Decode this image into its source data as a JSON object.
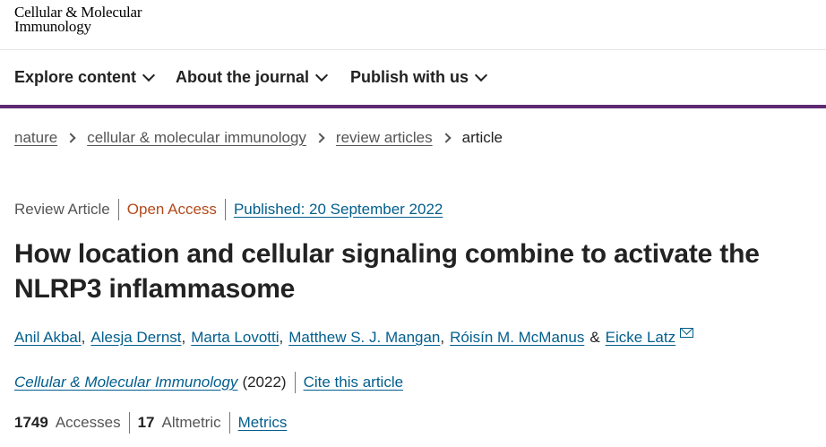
{
  "logo": {
    "line1": "Cellular & Molecular",
    "line2": "Immunology"
  },
  "nav": {
    "explore": "Explore content",
    "about": "About the journal",
    "publish": "Publish with us"
  },
  "breadcrumb": {
    "items": [
      "nature",
      "cellular & molecular immunology",
      "review articles"
    ],
    "current": "article"
  },
  "meta": {
    "article_type": "Review Article",
    "open_access": "Open Access",
    "published": "Published: 20 September 2022"
  },
  "title": "How location and cellular signaling combine to activate the NLRP3 inflammasome",
  "authors": [
    "Anil Akbal",
    "Alesja Dernst",
    "Marta Lovotti",
    "Matthew S. J. Mangan",
    "Róisín M. McManus",
    "Eicke Latz"
  ],
  "authors_separator": ",",
  "authors_last_joiner": "&",
  "journal": {
    "name": "Cellular & Molecular Immunology",
    "year": "(2022)",
    "cite": "Cite this article"
  },
  "metrics": {
    "accesses_count": "1749",
    "accesses_label": "Accesses",
    "altmetric_count": "17",
    "altmetric_label": "Altmetric",
    "metrics_link": "Metrics"
  },
  "colors": {
    "link": "#025e8d",
    "accent_bar": "#5e2a72",
    "open_access": "#b24a1c"
  }
}
